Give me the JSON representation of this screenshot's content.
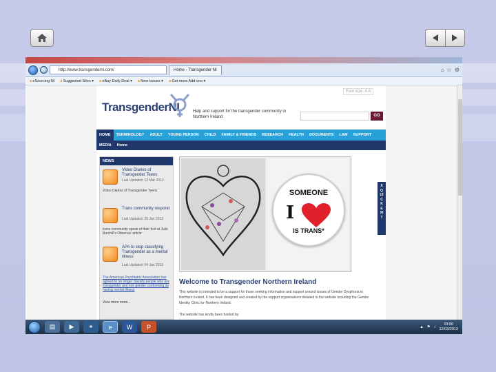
{
  "browser": {
    "url": "http://www.transgenderni.com/",
    "tab_title": "Home - Transgender NI",
    "favorites": [
      "eSourcing NI",
      "Suggested Sites ▾",
      "eBay Daily Deal ▾",
      "New Issues ▾",
      "Get more Add-ons ▾"
    ]
  },
  "site": {
    "font_size_label": "Font size: A A",
    "logo_text": "TransgenderNI",
    "tagline": "Help and support for the transgender community in Northern Ireland",
    "go_label": "GO",
    "nav": [
      "HOME",
      "TERMINOLOGY",
      "ADULT",
      "YOUNG PERSON",
      "CHILD",
      "FAMILY & FRIENDS",
      "RESEARCH",
      "HEALTH",
      "DOCUMENTS",
      "LAW",
      "SUPPORT"
    ],
    "subnav": [
      "MEDIA",
      "Home"
    ],
    "news": {
      "heading": "NEWS",
      "items": [
        {
          "title": "Video Diaries of Transgender Teens",
          "date": "Last Updated: 12 Mar 2013",
          "text": "Video Diaries of Transgender Teens"
        },
        {
          "title": "Trans community respond",
          "date": "Last Updated: 25 Jan 2013",
          "text": "trans community speak of their feel at Julie Burchill's Observer article"
        },
        {
          "title": "APA to stop classifying Transgender as a mental illness",
          "date": "Last Updated: 04 Jan 2013",
          "text": ""
        }
      ],
      "link": "The American Psychiatric Association has agreed to no longer classify people who are transgender and non gender conforming as having mental illness",
      "view_more": "View more more..."
    },
    "badge": {
      "line1": "SOMEONE",
      "letter": "I",
      "line2": "IS TRANS*"
    },
    "welcome": "Welcome to Transgender Northern Ireland",
    "intro": "This website is intended to be a support for those seeking information and support around issues of Gender Dysphoria in Northern Ireland. It has been designed and created by the support organisations detailed in the website including the Gender Identity Clinic for Northern Ireland.",
    "intro2": "The website has kindly been funded by",
    "quick_exit": "X QUICK EXIT"
  },
  "taskbar": {
    "time": "23:00",
    "date": "12/03/2013"
  },
  "colors": {
    "nav_blue": "#27a1d8",
    "navy": "#20376b",
    "go": "#6a1930",
    "heart": "#e0202a"
  }
}
